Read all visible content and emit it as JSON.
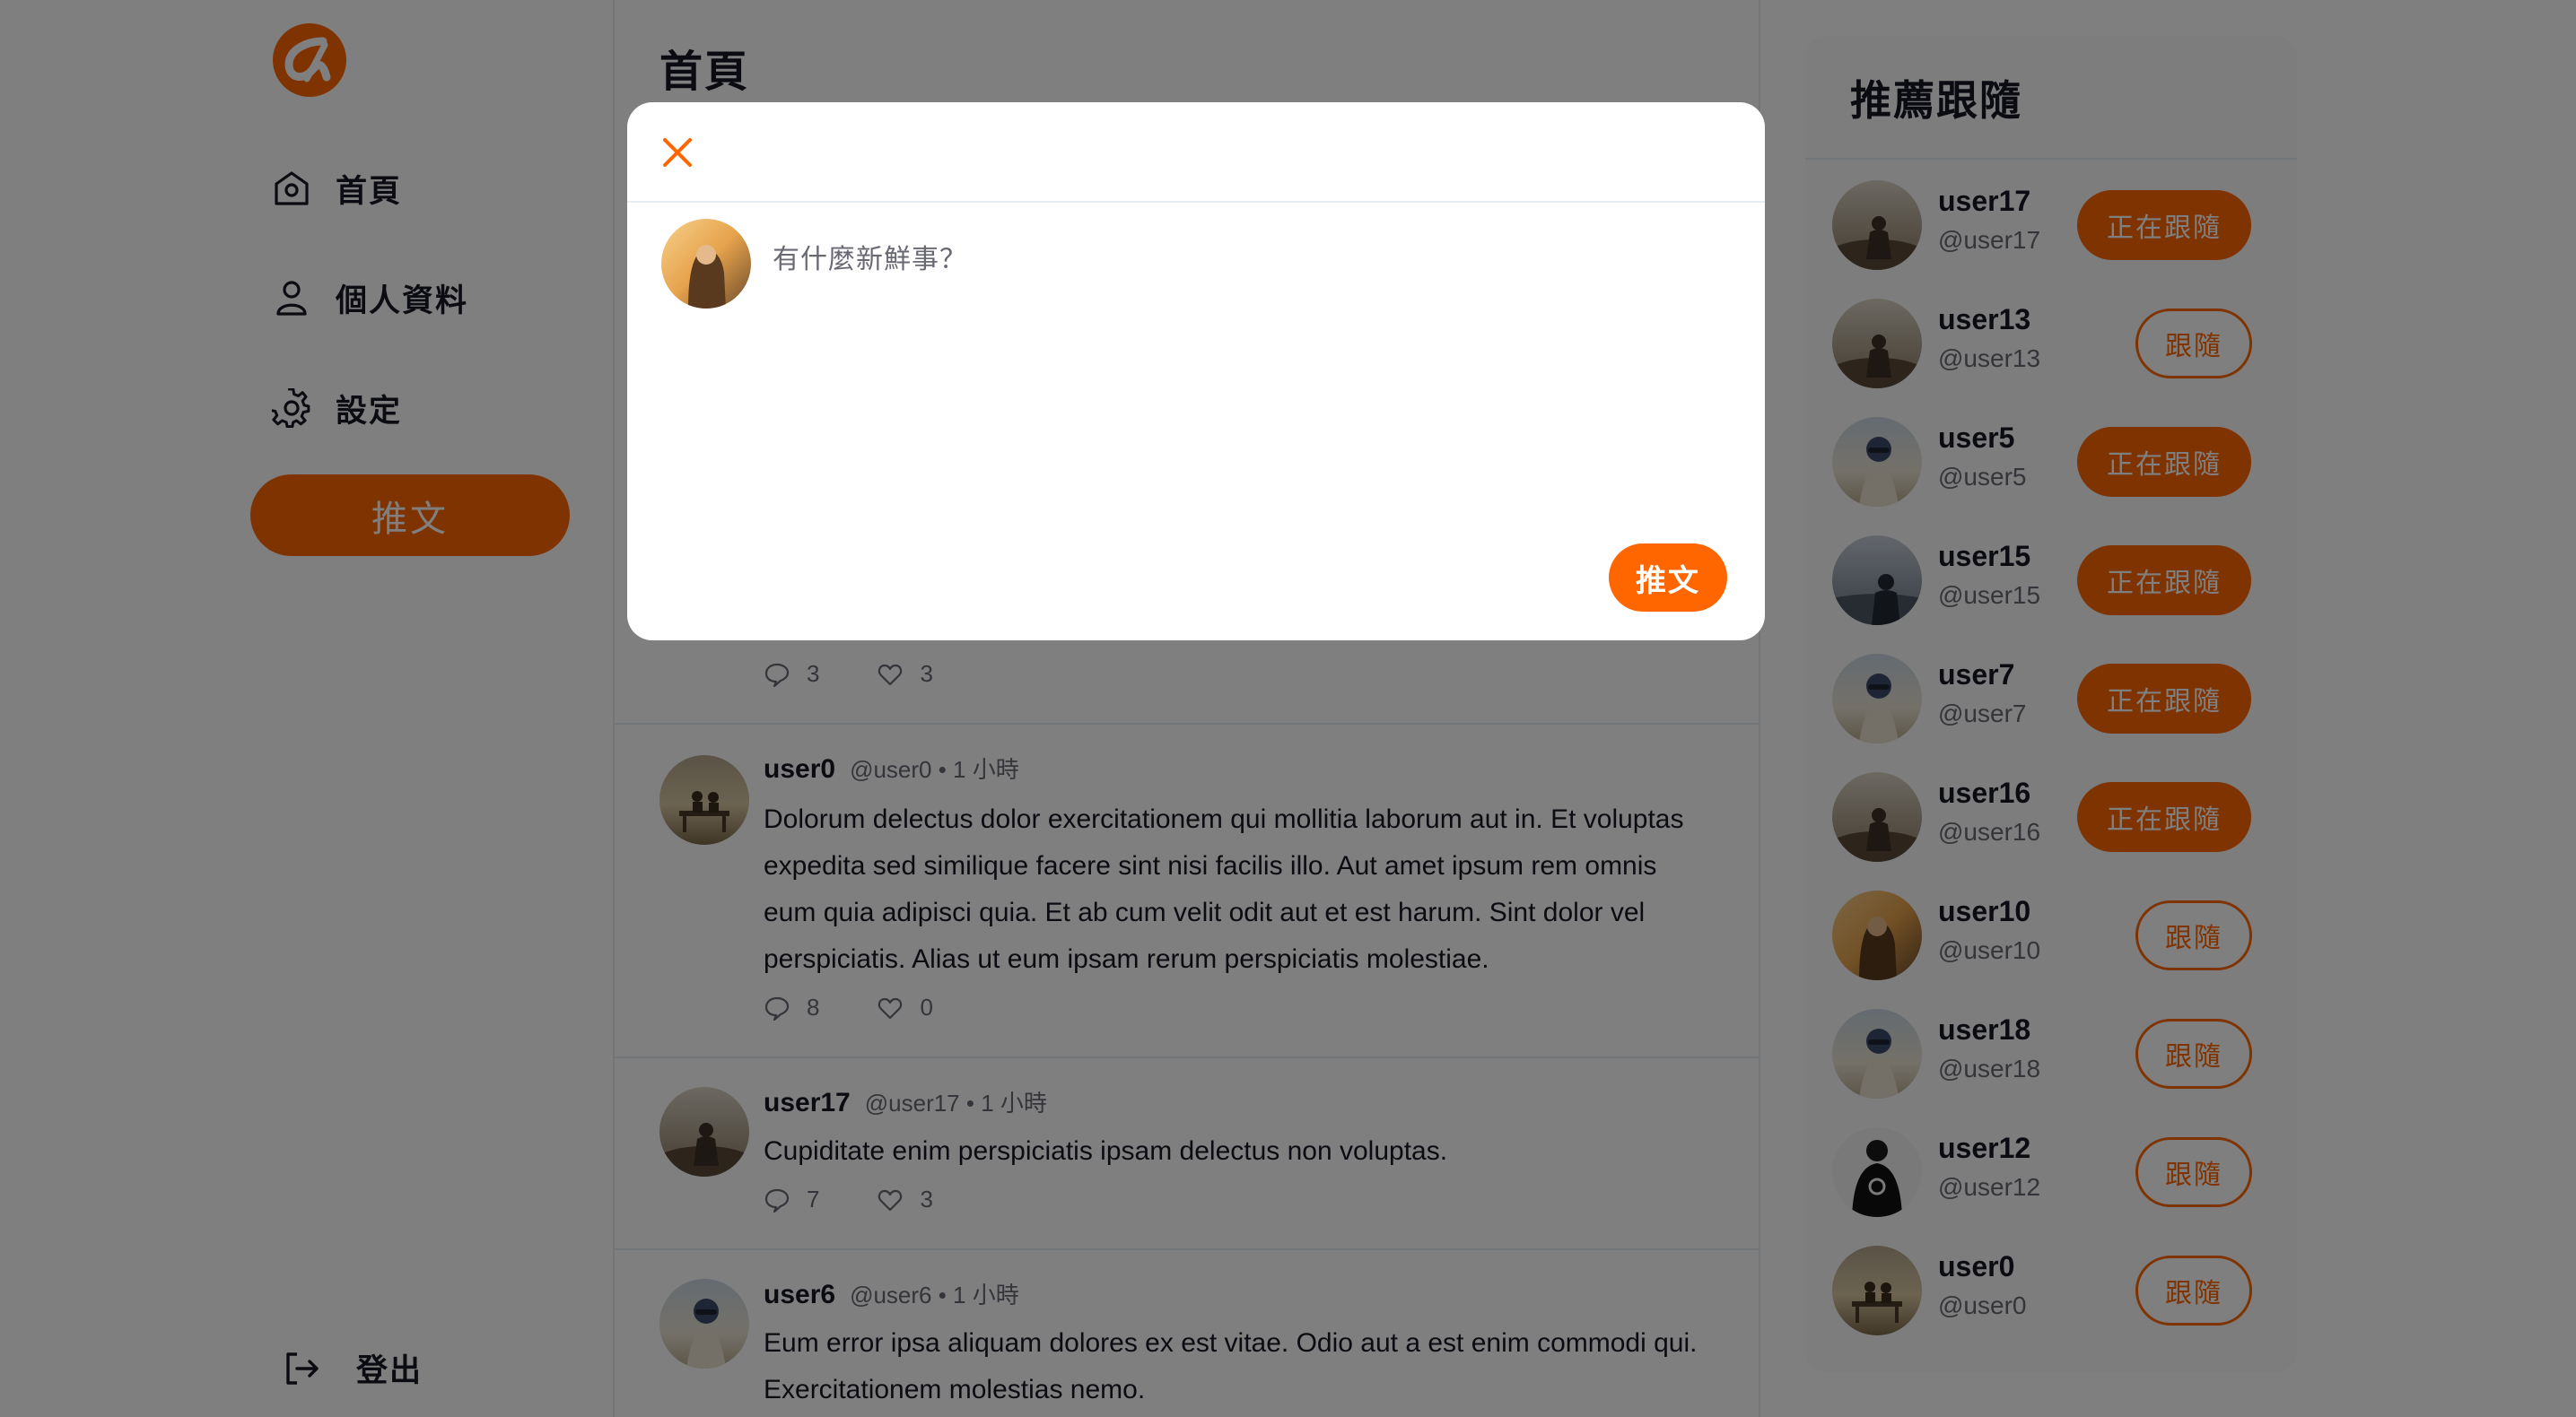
{
  "brand": {
    "accent": "#ff6600",
    "text": "#171725",
    "muted": "#696974",
    "icon": "alpha-logo-icon"
  },
  "nav": {
    "items": [
      {
        "label": "首頁",
        "icon": "home-icon"
      },
      {
        "label": "個人資料",
        "icon": "user-icon"
      },
      {
        "label": "設定",
        "icon": "gear-icon"
      }
    ],
    "tweet_button": "推文",
    "logout": {
      "label": "登出",
      "icon": "logout-icon"
    }
  },
  "main": {
    "title": "首頁",
    "prev_post": {
      "replies": "3",
      "likes": "3"
    },
    "posts": [
      {
        "name": "user0",
        "handle": "@user0 • 1 小時",
        "content": "Dolorum delectus dolor exercitationem qui mollitia laborum aut in. Et voluptas expedita sed similique facere sint nisi facilis illo. Aut amet ipsum rem omnis eum quia adipisci quia. Et ab cum velit odit aut et est harum. Sint dolor vel perspiciatis. Alias ut eum ipsam rerum perspiciatis molestiae.",
        "replies": "8",
        "likes": "0"
      },
      {
        "name": "user17",
        "handle": "@user17 • 1 小時",
        "content": "Cupiditate enim perspiciatis ipsam delectus non voluptas.",
        "replies": "7",
        "likes": "3"
      },
      {
        "name": "user6",
        "handle": "@user6 • 1 小時",
        "content": "Eum error ipsa aliquam dolores ex est vitae. Odio aut a est enim commodi qui. Exercitationem molestias nemo.",
        "replies": "",
        "likes": ""
      }
    ]
  },
  "recommend": {
    "title": "推薦跟隨",
    "users": [
      {
        "name": "user17",
        "handle": "@user17",
        "button": "正在跟隨",
        "following": true
      },
      {
        "name": "user13",
        "handle": "@user13",
        "button": "跟隨",
        "following": false
      },
      {
        "name": "user5",
        "handle": "@user5",
        "button": "正在跟隨",
        "following": true
      },
      {
        "name": "user15",
        "handle": "@user15",
        "button": "正在跟隨",
        "following": true
      },
      {
        "name": "user7",
        "handle": "@user7",
        "button": "正在跟隨",
        "following": true
      },
      {
        "name": "user16",
        "handle": "@user16",
        "button": "正在跟隨",
        "following": true
      },
      {
        "name": "user10",
        "handle": "@user10",
        "button": "跟隨",
        "following": false
      },
      {
        "name": "user18",
        "handle": "@user18",
        "button": "跟隨",
        "following": false
      },
      {
        "name": "user12",
        "handle": "@user12",
        "button": "跟隨",
        "following": false
      },
      {
        "name": "user0",
        "handle": "@user0",
        "button": "跟隨",
        "following": false
      }
    ]
  },
  "modal": {
    "placeholder": "有什麼新鮮事？",
    "submit": "推文",
    "close_icon": "close-icon"
  }
}
